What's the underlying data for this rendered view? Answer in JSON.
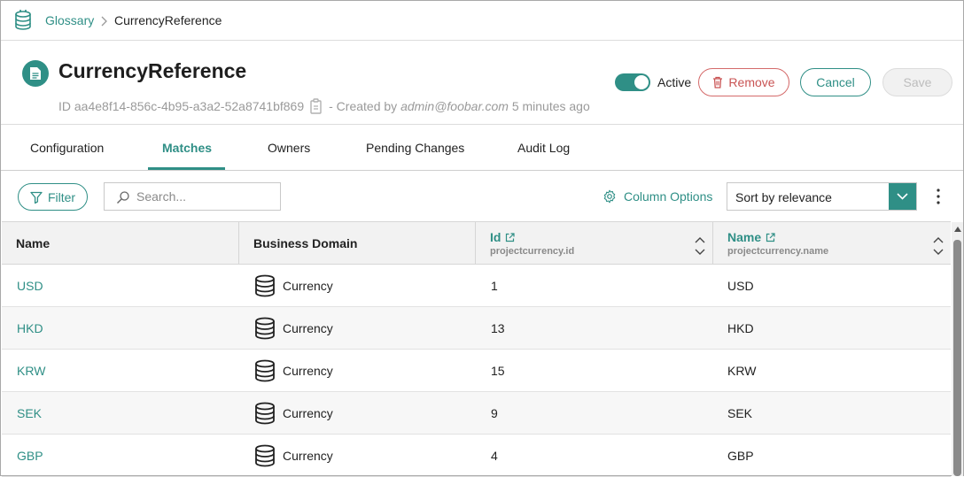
{
  "breadcrumb": {
    "parent": "Glossary",
    "current": "CurrencyReference"
  },
  "header": {
    "title": "CurrencyReference",
    "id_label": "ID",
    "id_value": "aa4e8f14-856c-4b95-a3a2-52a8741bf869",
    "created_prefix": "- Created by",
    "created_by": "admin@foobar.com",
    "created_ago": "5 minutes ago",
    "active_label": "Active",
    "active": true,
    "remove_label": "Remove",
    "cancel_label": "Cancel",
    "save_label": "Save"
  },
  "tabs": [
    {
      "label": "Configuration",
      "active": false
    },
    {
      "label": "Matches",
      "active": true
    },
    {
      "label": "Owners",
      "active": false
    },
    {
      "label": "Pending Changes",
      "active": false
    },
    {
      "label": "Audit Log",
      "active": false
    }
  ],
  "toolbar": {
    "filter_label": "Filter",
    "search_placeholder": "Search...",
    "column_options_label": "Column Options",
    "sort_value": "Sort by relevance"
  },
  "table": {
    "columns": [
      {
        "label": "Name",
        "sub": ""
      },
      {
        "label": "Business Domain",
        "sub": ""
      },
      {
        "label": "Id",
        "sub": "projectcurrency.id"
      },
      {
        "label": "Name",
        "sub": "projectcurrency.name"
      }
    ],
    "rows": [
      {
        "name": "USD",
        "domain": "Currency",
        "id": "1",
        "value": "USD"
      },
      {
        "name": "HKD",
        "domain": "Currency",
        "id": "13",
        "value": "HKD"
      },
      {
        "name": "KRW",
        "domain": "Currency",
        "id": "15",
        "value": "KRW"
      },
      {
        "name": "SEK",
        "domain": "Currency",
        "id": "9",
        "value": "SEK"
      },
      {
        "name": "GBP",
        "domain": "Currency",
        "id": "4",
        "value": "GBP"
      }
    ]
  },
  "colors": {
    "accent": "#2f8f86",
    "danger": "#c95454"
  },
  "icons": [
    "database-icon",
    "chevron-right-icon",
    "document-icon",
    "clipboard-icon",
    "trash-icon",
    "filter-icon",
    "search-icon",
    "gear-icon",
    "chevron-down-icon",
    "kebab-menu-icon",
    "external-link-icon",
    "sort-icon"
  ]
}
